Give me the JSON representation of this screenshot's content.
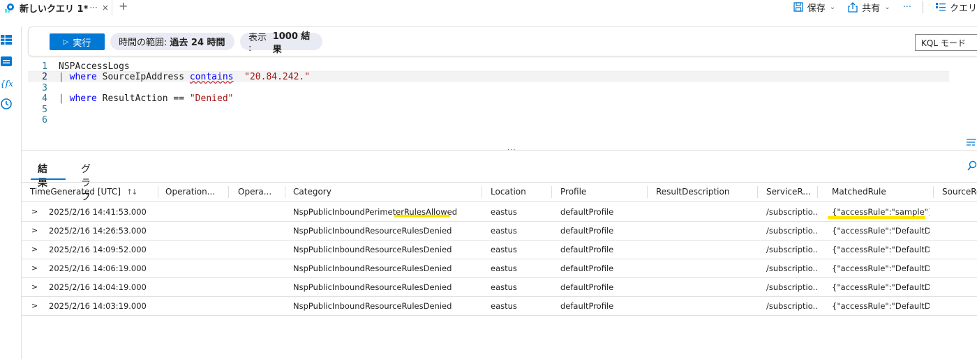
{
  "tab": {
    "title": "新しいクエリ 1*",
    "more": "···",
    "close": "×",
    "add": "+"
  },
  "top_actions": {
    "save": "保存",
    "share": "共有",
    "more": "···",
    "queries": "クエリ"
  },
  "toolbar": {
    "run_label": "実行",
    "time_range_prefix": "時間の範囲:",
    "time_range_value": "過去 24 時間",
    "show_prefix": "表示 :",
    "show_value": "1000 結果",
    "mode_label": "KQL モード"
  },
  "editor": {
    "line_numbers": [
      "1",
      "2",
      "3",
      "4",
      "5",
      "6"
    ],
    "lines": [
      {
        "text": "NSPAccessLogs"
      },
      {
        "pipe": "| ",
        "kw": "where",
        "mid": " SourceIpAddress ",
        "op": "contains",
        "gap": "  ",
        "str": "\"20.84.242.\""
      },
      {
        "text": ""
      },
      {
        "pipe": "| ",
        "kw": "where",
        "mid": " ResultAction == ",
        "str": "\"Denied\""
      },
      {
        "text": ""
      },
      {
        "text": ""
      }
    ],
    "splitter_dots": "···"
  },
  "results_tabs": [
    "結果",
    "グラフ"
  ],
  "columns": [
    "TimeGenerated [UTC]",
    "Operation...",
    "Opera...",
    "Category",
    "Location",
    "Profile",
    "ResultDescription",
    "ServiceR...",
    "MatchedRule",
    "SourceRe"
  ],
  "rows": [
    {
      "time": "2025/2/16 14:41:53.000",
      "category": "NspPublicInboundPerimeterRulesAllowed",
      "location": "eastus",
      "profile": "defaultProfile",
      "service": "/subscriptio...",
      "rule": "{\"accessRule\":\"sample\"}"
    },
    {
      "time": "2025/2/16 14:26:53.000",
      "category": "NspPublicInboundResourceRulesDenied",
      "location": "eastus",
      "profile": "defaultProfile",
      "service": "/subscriptio...",
      "rule": "{\"accessRule\":\"DefaultDe..."
    },
    {
      "time": "2025/2/16 14:09:52.000",
      "category": "NspPublicInboundResourceRulesDenied",
      "location": "eastus",
      "profile": "defaultProfile",
      "service": "/subscriptio...",
      "rule": "{\"accessRule\":\"DefaultDe..."
    },
    {
      "time": "2025/2/16 14:06:19.000",
      "category": "NspPublicInboundResourceRulesDenied",
      "location": "eastus",
      "profile": "defaultProfile",
      "service": "/subscriptio...",
      "rule": "{\"accessRule\":\"DefaultDe..."
    },
    {
      "time": "2025/2/16 14:04:19.000",
      "category": "NspPublicInboundResourceRulesDenied",
      "location": "eastus",
      "profile": "defaultProfile",
      "service": "/subscriptio...",
      "rule": "{\"accessRule\":\"DefaultDe..."
    },
    {
      "time": "2025/2/16 14:03:19.000",
      "category": "NspPublicInboundResourceRulesDenied",
      "location": "eastus",
      "profile": "defaultProfile",
      "service": "/subscriptio...",
      "rule": "{\"accessRule\":\"DefaultDe..."
    }
  ],
  "colors": {
    "accent": "#0078d4",
    "highlight": "#ffe600",
    "keyword": "#0000ff",
    "string": "#a31515"
  }
}
